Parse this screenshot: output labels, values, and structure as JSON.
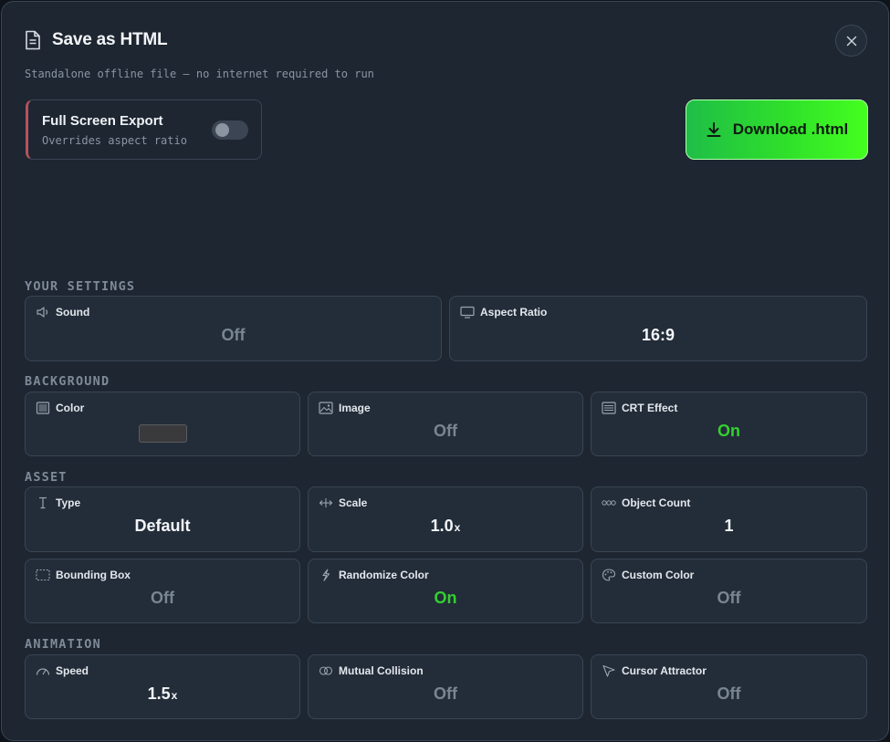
{
  "dialog": {
    "title": "Save as HTML",
    "subtitle": "Standalone offline file — no internet required to run",
    "icon": "document-icon",
    "close_icon": "close-icon"
  },
  "full_screen": {
    "title": "Full Screen Export",
    "subtitle": "Overrides aspect ratio",
    "enabled": false
  },
  "download": {
    "label": "Download .html",
    "icon": "download-icon"
  },
  "sections": {
    "your_settings": "YOUR SETTINGS",
    "background": "BACKGROUND",
    "asset": "ASSET",
    "animation": "ANIMATION"
  },
  "settings": {
    "sound": {
      "label": "Sound",
      "value": "Off",
      "icon": "speaker-icon"
    },
    "aspect_ratio": {
      "label": "Aspect Ratio",
      "value": "16:9",
      "icon": "monitor-icon"
    }
  },
  "background": {
    "color": {
      "label": "Color",
      "swatch": "#3a3a3c",
      "icon": "color-square-icon"
    },
    "image": {
      "label": "Image",
      "value": "Off",
      "icon": "image-icon"
    },
    "crt": {
      "label": "CRT Effect",
      "value": "On",
      "icon": "scanlines-icon"
    }
  },
  "asset": {
    "type": {
      "label": "Type",
      "value": "Default",
      "icon": "text-cursor-icon"
    },
    "scale": {
      "label": "Scale",
      "value": "1.0",
      "unit": "x",
      "icon": "scale-arrows-icon"
    },
    "object_count": {
      "label": "Object Count",
      "value": "1",
      "icon": "circles-icon"
    },
    "bounding_box": {
      "label": "Bounding Box",
      "value": "Off",
      "icon": "dashed-box-icon"
    },
    "randomize_color": {
      "label": "Randomize Color",
      "value": "On",
      "icon": "lightning-icon"
    },
    "custom_color": {
      "label": "Custom Color",
      "value": "Off",
      "icon": "palette-icon"
    }
  },
  "animation": {
    "speed": {
      "label": "Speed",
      "value": "1.5",
      "unit": "x",
      "icon": "speedometer-icon"
    },
    "mutual_collision": {
      "label": "Mutual Collision",
      "value": "Off",
      "icon": "overlap-circles-icon"
    },
    "cursor_attractor": {
      "label": "Cursor Attractor",
      "value": "Off",
      "icon": "cursor-arrow-icon"
    }
  },
  "colors": {
    "on": "#34d030",
    "off": "#7a8593",
    "accent_green": "#2fe02a",
    "panel": "#1d2631"
  }
}
